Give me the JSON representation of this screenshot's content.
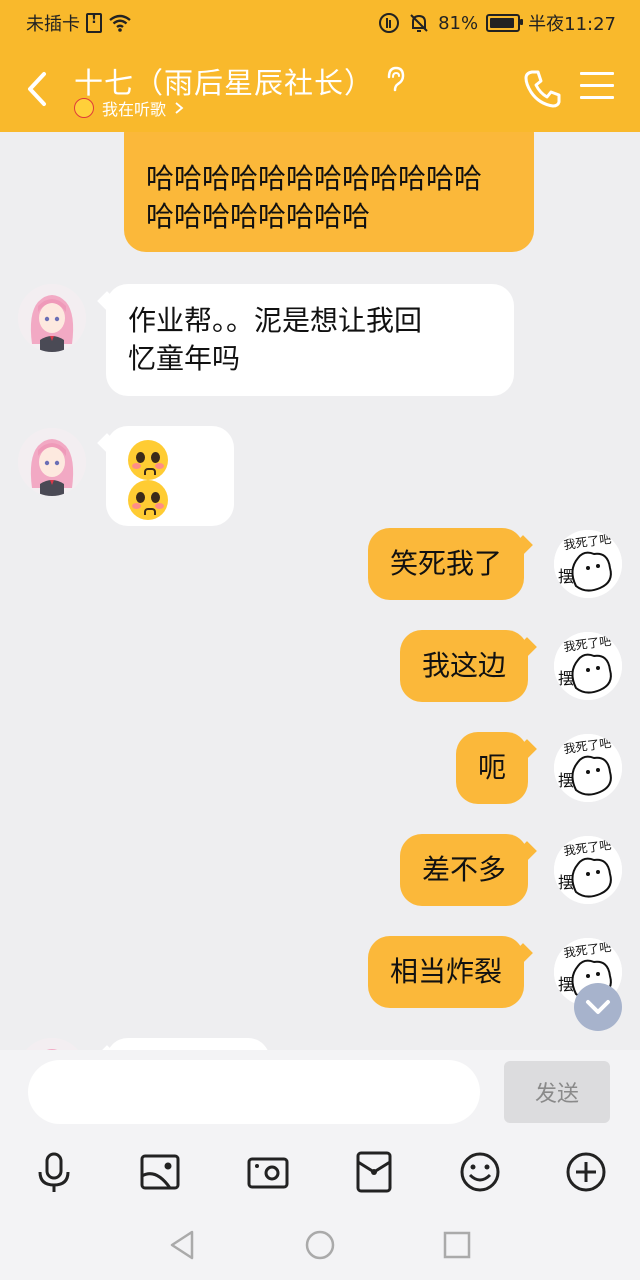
{
  "status_bar": {
    "carrier": "未插卡",
    "battery_percent": "81%",
    "battery_level": 0.81,
    "time": "半夜11:27"
  },
  "header": {
    "title": "十七（雨后星辰社长）",
    "subtitle": "我在听歌"
  },
  "messages": [
    {
      "side": "out",
      "text_lines": [
        "哈哈哈哈哈哈哈哈哈哈哈哈",
        "哈哈哈哈哈哈哈哈"
      ]
    },
    {
      "side": "in",
      "text_lines": [
        "作业帮。。泥是想让我回",
        "忆童年吗"
      ]
    },
    {
      "side": "in",
      "emoji": "pleading-face-emoji"
    },
    {
      "side": "out",
      "text": "笑死我了"
    },
    {
      "side": "out",
      "text": "我这边"
    },
    {
      "side": "out",
      "text": "呃"
    },
    {
      "side": "out",
      "text": "差不多"
    },
    {
      "side": "out",
      "text": "相当炸裂"
    }
  ],
  "sticker_avatar_text": "我死了吧",
  "sticker_side_text": "摆",
  "input": {
    "placeholder": "",
    "send_label": "发送"
  },
  "toolbar_icons": [
    "microphone-icon",
    "image-icon",
    "camera-icon",
    "red-packet-icon",
    "emoji-icon",
    "add-icon"
  ],
  "colors": {
    "accent": "#f9b92c",
    "bubble_out": "#fbb83a",
    "bubble_in": "#ffffff",
    "chat_background": "#eeeef0"
  }
}
